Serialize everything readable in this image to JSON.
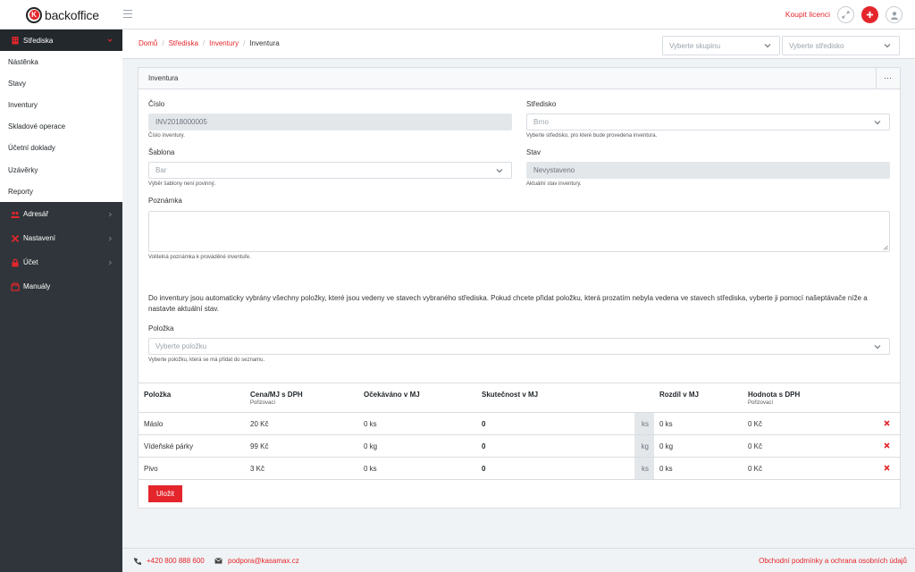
{
  "header": {
    "brand": "backoffice",
    "logo_letter": "K",
    "buy_license": "Koupit licenci"
  },
  "sidebar": {
    "active_section": "Střediska",
    "sub_items": [
      "Nástěnka",
      "Stavy",
      "Inventury",
      "Skladové operace",
      "Účetní doklady",
      "Uzávěrky",
      "Reporty"
    ],
    "items": [
      {
        "label": "Adresář",
        "icon": "people-icon"
      },
      {
        "label": "Nastavení",
        "icon": "tools-icon"
      },
      {
        "label": "Účet",
        "icon": "lock-icon"
      },
      {
        "label": "Manuály",
        "icon": "box-icon"
      }
    ]
  },
  "breadcrumb": {
    "items": [
      "Domů",
      "Střediska",
      "Inventury"
    ],
    "current": "Inventura"
  },
  "header_selects": {
    "group_placeholder": "Vyberte skupinu",
    "center_placeholder": "Vyberte středisko"
  },
  "card": {
    "title": "Inventura",
    "menu_icon": "⋯"
  },
  "form": {
    "cislo_label": "Číslo",
    "cislo_value": "INV2018000005",
    "cislo_help": "Číslo inventury.",
    "stredisko_label": "Středisko",
    "stredisko_value": "Brno",
    "stredisko_help": "Vyberte středisko, pro které bude provedena inventura.",
    "sablona_label": "Šablona",
    "sablona_value": "Bar",
    "sablona_help": "Výběr šablony není povinný.",
    "stav_label": "Stav",
    "stav_value": "Nevystaveno",
    "stav_help": "Aktuální stav inventury.",
    "poznamka_label": "Poznámka",
    "poznamka_help": "Volitelná poznámka k prováděné inventuře.",
    "info_text": "Do inventury jsou automaticky vybrány všechny položky, které jsou vedeny ve stavech vybraného střediska. Pokud chcete přidat položku, která prozatím nebyla vedena ve stavech střediska, vyberte ji pomocí našeptávače níže a nastavte aktuální stav.",
    "polozka_label": "Položka",
    "polozka_placeholder": "Vyberte položku",
    "polozka_help": "Vyberte položku, která se má přidat do seznamu."
  },
  "table": {
    "headers": {
      "item": "Položka",
      "price": "Cena/MJ s DPH",
      "price_sub": "Pořizovací",
      "expected": "Očekáváno v MJ",
      "actual": "Skutečnost v MJ",
      "diff": "Rozdíl v MJ",
      "value": "Hodnota s DPH",
      "value_sub": "Pořizovací"
    },
    "rows": [
      {
        "item": "Máslo",
        "price": "20 Kč",
        "expected": "0 ks",
        "actual": "0",
        "unit": "ks",
        "diff": "0 ks",
        "value": "0 Kč"
      },
      {
        "item": "Vídeňské párky",
        "price": "99 Kč",
        "expected": "0 kg",
        "actual": "0",
        "unit": "kg",
        "diff": "0 kg",
        "value": "0 Kč"
      },
      {
        "item": "Pivo",
        "price": "3 Kč",
        "expected": "0 ks",
        "actual": "0",
        "unit": "ks",
        "diff": "0 ks",
        "value": "0 Kč"
      }
    ]
  },
  "actions": {
    "save": "Uložit"
  },
  "footer": {
    "phone": "+420 800 888 600",
    "email": "podpora@kasamax.cz",
    "terms": "Obchodní podmínky a ochrana osobních údajů"
  },
  "colors": {
    "accent": "#e4262c",
    "sidebar_bg": "#2f353a"
  }
}
